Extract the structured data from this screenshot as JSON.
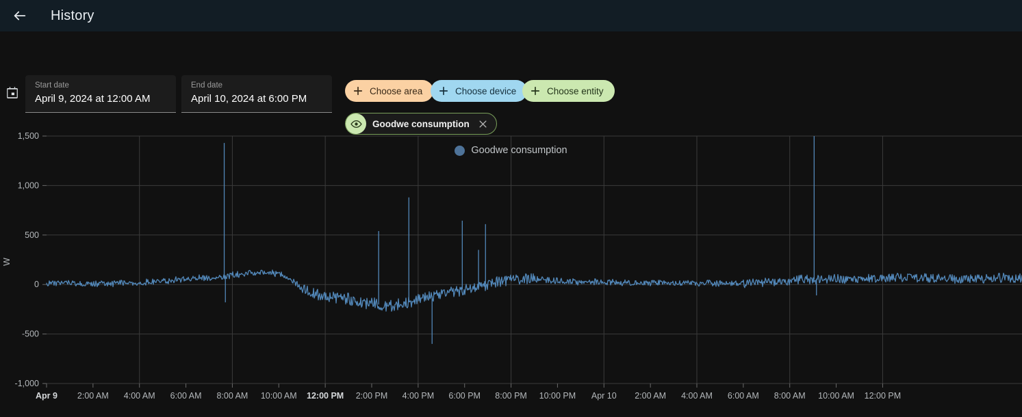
{
  "appbar": {
    "back_icon": "arrow-left-icon",
    "title": "History"
  },
  "toolbar": {
    "calendar_icon": "calendar-icon",
    "start": {
      "label": "Start date",
      "value": "April 9, 2024 at 12:00 AM"
    },
    "end": {
      "label": "End date",
      "value": "April 10, 2024 at 6:00 PM"
    },
    "chips": [
      {
        "id": "area",
        "label": "Choose area",
        "icon": "plus-icon",
        "color": "#fbd1a3"
      },
      {
        "id": "device",
        "label": "Choose device",
        "icon": "plus-icon",
        "color": "#a0d7f0"
      },
      {
        "id": "entity",
        "label": "Choose entity",
        "icon": "plus-icon",
        "color": "#cbe8b0"
      }
    ],
    "selected_entity": {
      "label": "Goodwe consumption",
      "avatar_icon": "eye-icon",
      "remove_icon": "close-icon",
      "accent": "#cbe8b0"
    }
  },
  "legend": {
    "items": [
      {
        "label": "Goodwe consumption",
        "color": "#4e7399",
        "marker": "circle"
      }
    ]
  },
  "chart_data": {
    "type": "line",
    "title": "",
    "xlabel": "",
    "ylabel": "W",
    "unit": "W",
    "grid": true,
    "legend_position": "top-center",
    "series": [
      {
        "name": "Goodwe consumption",
        "color": "#5287b8"
      }
    ],
    "ylim": [
      -1000,
      1500
    ],
    "yticks": [
      1500,
      1000,
      500,
      0,
      -500,
      -1000
    ],
    "ytick_labels": [
      "1,500",
      "1,000",
      "500",
      "0",
      "-500",
      "-1,000"
    ],
    "xlim_hours": [
      0,
      42
    ],
    "xticks_hours": [
      0,
      2,
      4,
      6,
      8,
      10,
      12,
      14,
      16,
      18,
      20,
      22,
      24,
      26,
      28,
      30,
      32,
      34,
      36
    ],
    "xtick_labels": [
      "Apr 9",
      "2:00 AM",
      "4:00 AM",
      "6:00 AM",
      "8:00 AM",
      "10:00 AM",
      "12:00 PM",
      "2:00 PM",
      "4:00 PM",
      "6:00 PM",
      "8:00 PM",
      "10:00 PM",
      "Apr 10",
      "2:00 AM",
      "4:00 AM",
      "6:00 AM",
      "8:00 AM",
      "10:00 AM",
      "12:00 PM"
    ],
    "xtick_bold": [
      0,
      12
    ],
    "baseline_hours": [
      0,
      1,
      2,
      3,
      4,
      5,
      6,
      6.6,
      7,
      7.5,
      8,
      8.5,
      9,
      9.5,
      10,
      10.5,
      11,
      11.5,
      12,
      12.5,
      13,
      13.5,
      14,
      14.5,
      15,
      15.5,
      16,
      16.5,
      17,
      17.5,
      18,
      18.5,
      19,
      19.5,
      20,
      21,
      22,
      23,
      24,
      25,
      26,
      27,
      28,
      29,
      30,
      31,
      32,
      32.5,
      33,
      34,
      35,
      36,
      37,
      38,
      39,
      40,
      41,
      42
    ],
    "baseline_values": [
      15,
      10,
      8,
      12,
      20,
      35,
      55,
      70,
      60,
      75,
      95,
      110,
      120,
      130,
      105,
      55,
      -40,
      -95,
      -120,
      -135,
      -150,
      -175,
      -190,
      -210,
      -215,
      -185,
      -150,
      -120,
      -95,
      -70,
      -45,
      -20,
      10,
      35,
      55,
      60,
      40,
      25,
      20,
      18,
      15,
      12,
      10,
      12,
      15,
      20,
      35,
      60,
      50,
      55,
      60,
      65,
      70,
      60,
      55,
      60,
      65,
      60
    ],
    "noise_amplitude": 28,
    "spikes": [
      {
        "hours": 7.65,
        "value": 1430
      },
      {
        "hours": 7.7,
        "value": -180
      },
      {
        "hours": 14.3,
        "value": 540
      },
      {
        "hours": 15.6,
        "value": 880
      },
      {
        "hours": 16.6,
        "value": -600
      },
      {
        "hours": 17.9,
        "value": 645
      },
      {
        "hours": 18.6,
        "value": 350
      },
      {
        "hours": 18.9,
        "value": 610
      },
      {
        "hours": 33.05,
        "value": 1500
      },
      {
        "hours": 33.15,
        "value": -110
      }
    ]
  }
}
